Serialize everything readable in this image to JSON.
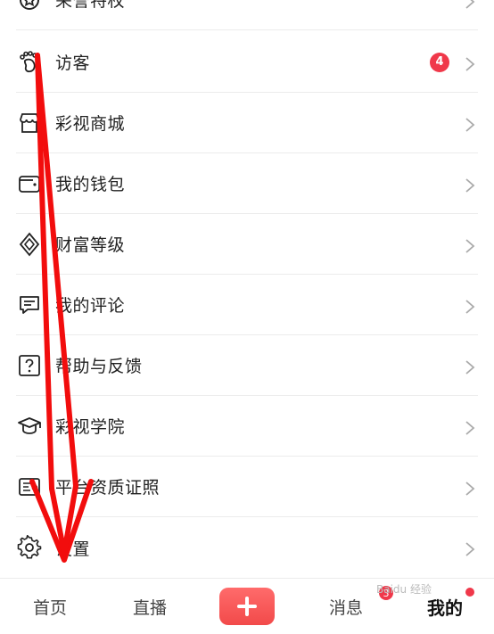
{
  "menu": {
    "items": [
      {
        "label": "荣誉特权",
        "icon": "medal-icon"
      },
      {
        "label": "访客",
        "icon": "footprint-icon",
        "badge": "4"
      },
      {
        "label": "彩视商城",
        "icon": "store-icon"
      },
      {
        "label": "我的钱包",
        "icon": "wallet-icon"
      },
      {
        "label": "财富等级",
        "icon": "diamond-icon"
      },
      {
        "label": "我的评论",
        "icon": "comment-icon"
      },
      {
        "label": "帮助与反馈",
        "icon": "question-icon"
      },
      {
        "label": "彩视学院",
        "icon": "graduation-cap-icon"
      },
      {
        "label": "平台资质证照",
        "icon": "license-icon"
      },
      {
        "label": "设置",
        "icon": "gear-icon"
      }
    ]
  },
  "tabbar": {
    "home": "首页",
    "live": "直播",
    "messages": "消息",
    "messages_badge": "3",
    "mine": "我的"
  },
  "watermark": "Baidu 经验"
}
